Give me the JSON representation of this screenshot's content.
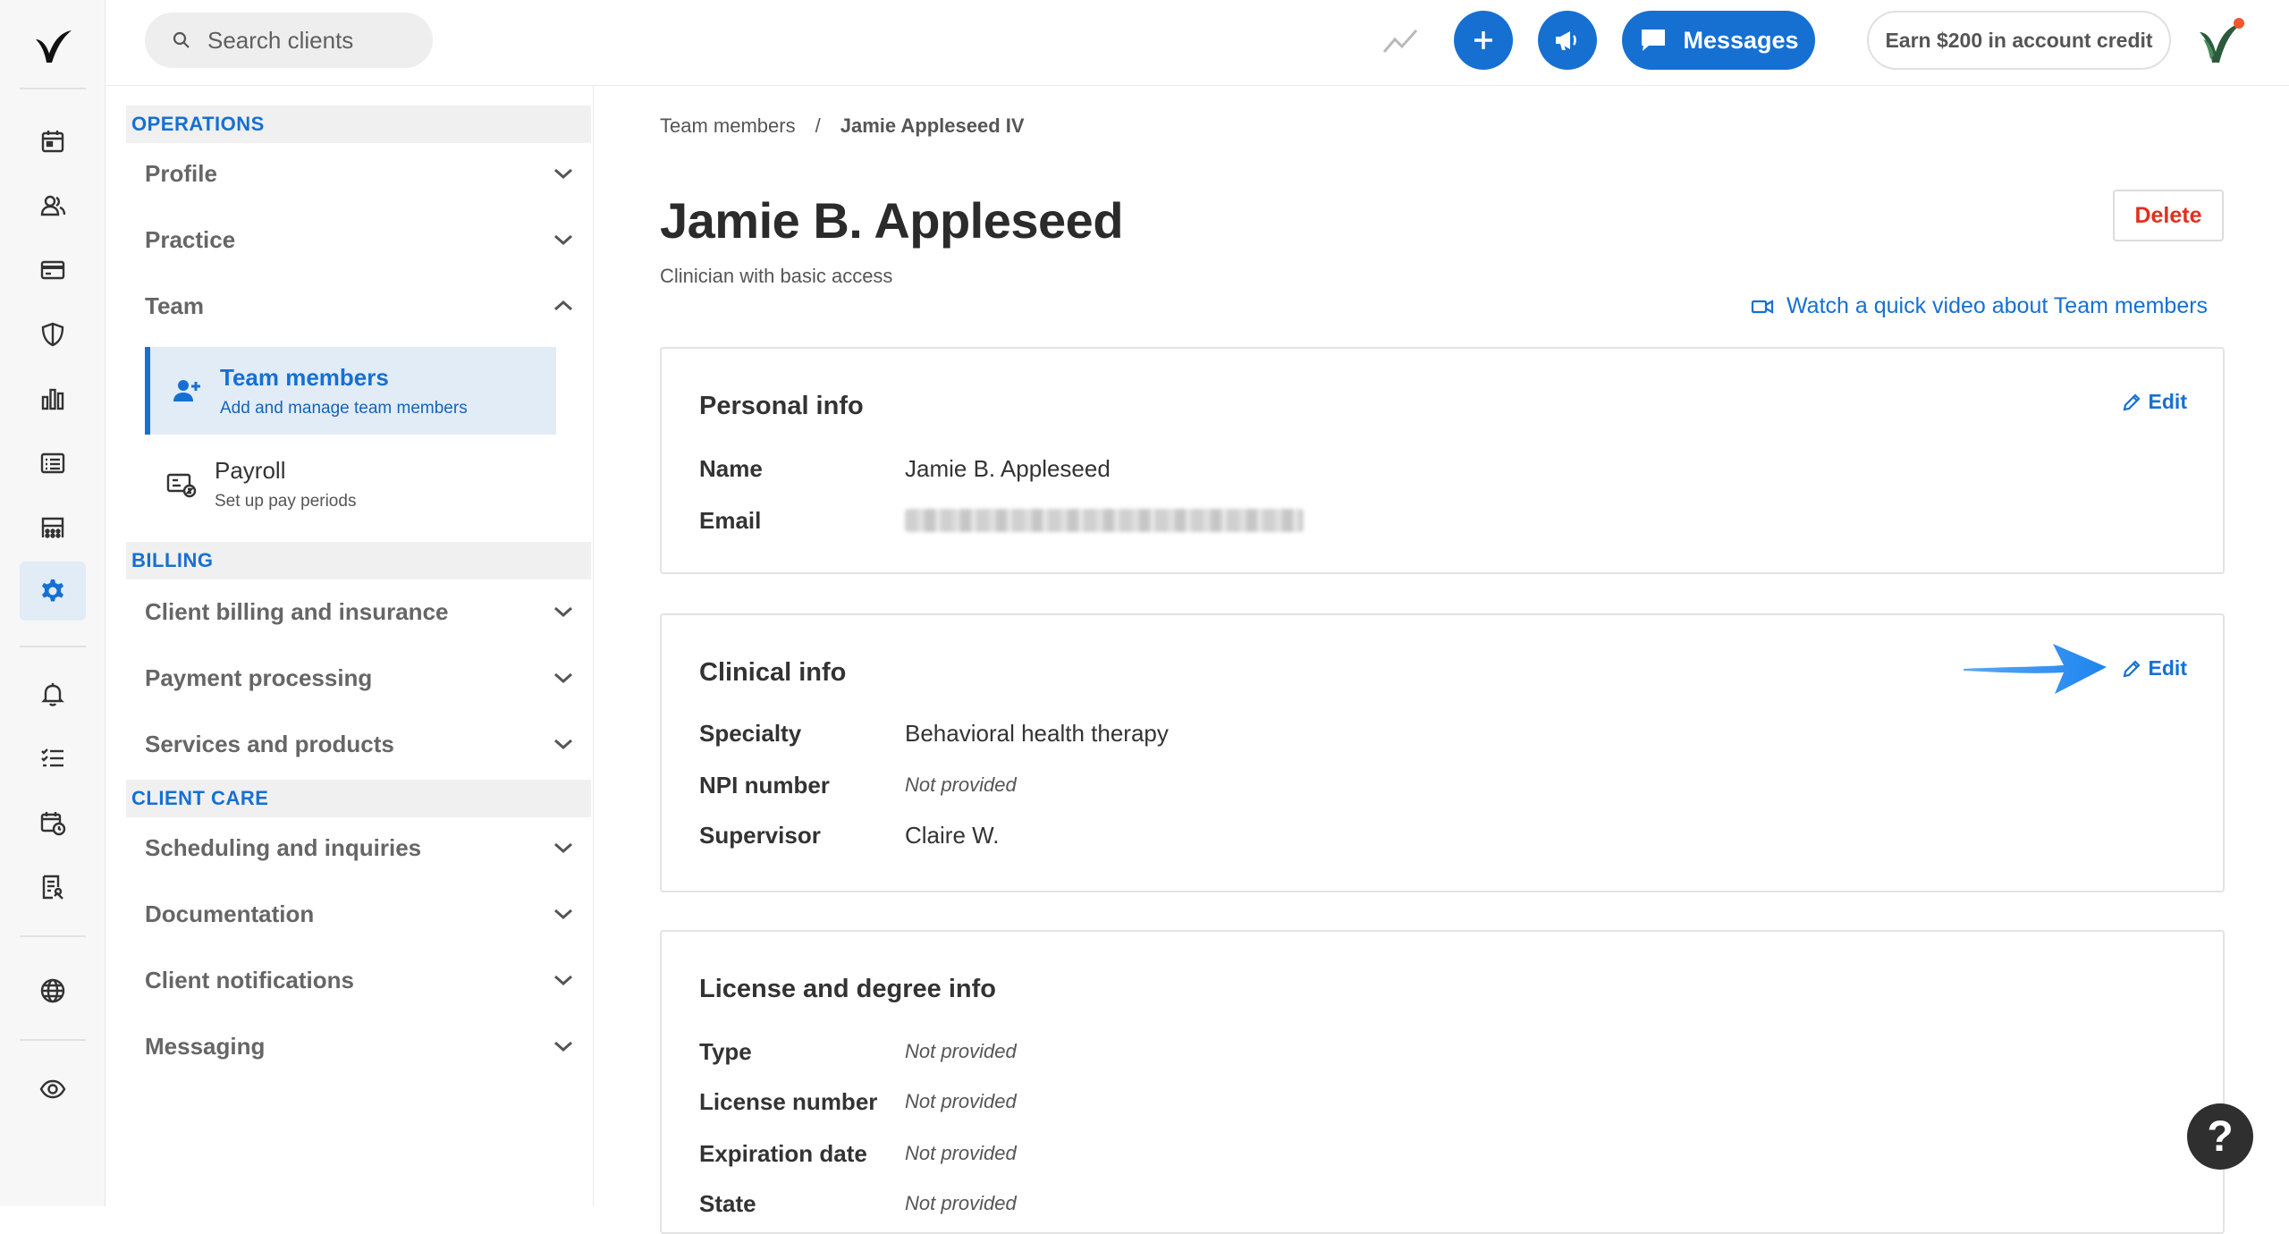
{
  "search": {
    "placeholder": "Search clients"
  },
  "topbar": {
    "messages_label": "Messages",
    "credit_label": "Earn $200 in account credit"
  },
  "sidebar": {
    "sections": {
      "operations": "OPERATIONS",
      "billing": "BILLING",
      "client_care": "CLIENT CARE"
    },
    "items": {
      "profile": "Profile",
      "practice": "Practice",
      "team": "Team",
      "client_billing": "Client billing and insurance",
      "payment_processing": "Payment processing",
      "services_products": "Services and products",
      "scheduling": "Scheduling and inquiries",
      "documentation": "Documentation",
      "client_notifications": "Client notifications",
      "messaging": "Messaging"
    },
    "team_sub": [
      {
        "title": "Team members",
        "desc": "Add and manage team members"
      },
      {
        "title": "Payroll",
        "desc": "Set up pay periods"
      }
    ]
  },
  "breadcrumb": {
    "parent": "Team members",
    "separator": "/",
    "current": "Jamie Appleseed IV"
  },
  "page": {
    "title": "Jamie B. Appleseed",
    "subtitle": "Clinician with basic access",
    "delete_label": "Delete",
    "video_link": "Watch a quick video about Team members"
  },
  "personal": {
    "title": "Personal info",
    "edit": "Edit",
    "name_label": "Name",
    "name_value": "Jamie B. Appleseed",
    "email_label": "Email"
  },
  "clinical": {
    "title": "Clinical info",
    "edit": "Edit",
    "specialty_label": "Specialty",
    "specialty_value": "Behavioral health therapy",
    "npi_label": "NPI number",
    "npi_value": "Not provided",
    "supervisor_label": "Supervisor",
    "supervisor_value": "Claire W."
  },
  "license": {
    "title": "License and degree info",
    "type_label": "Type",
    "type_value": "Not provided",
    "number_label": "License number",
    "number_value": "Not provided",
    "exp_label": "Expiration date",
    "exp_value": "Not provided",
    "state_label": "State",
    "state_value": "Not provided"
  },
  "help": {
    "label": "?"
  },
  "colors": {
    "accent": "#1670d2",
    "delete": "#e0301e",
    "active_bg": "#e2ecf7",
    "arrow": "#2a8cf0"
  },
  "icons": [
    "logo-icon",
    "calendar-icon",
    "clients-icon",
    "billing-card-icon",
    "shield-icon",
    "bar-chart-icon",
    "list-icon",
    "marketplace-icon",
    "gear-icon",
    "bell-icon",
    "checklist-icon",
    "calendar-clock-icon",
    "document-icon",
    "globe-icon",
    "eye-icon",
    "search-icon",
    "trend-icon",
    "plus-icon",
    "megaphone-icon",
    "chat-icon",
    "avatar-logo-icon",
    "chevron-down-icon",
    "chevron-up-icon",
    "add-person-icon",
    "payroll-icon",
    "video-icon",
    "pencil-icon",
    "arrow-annotation"
  ]
}
